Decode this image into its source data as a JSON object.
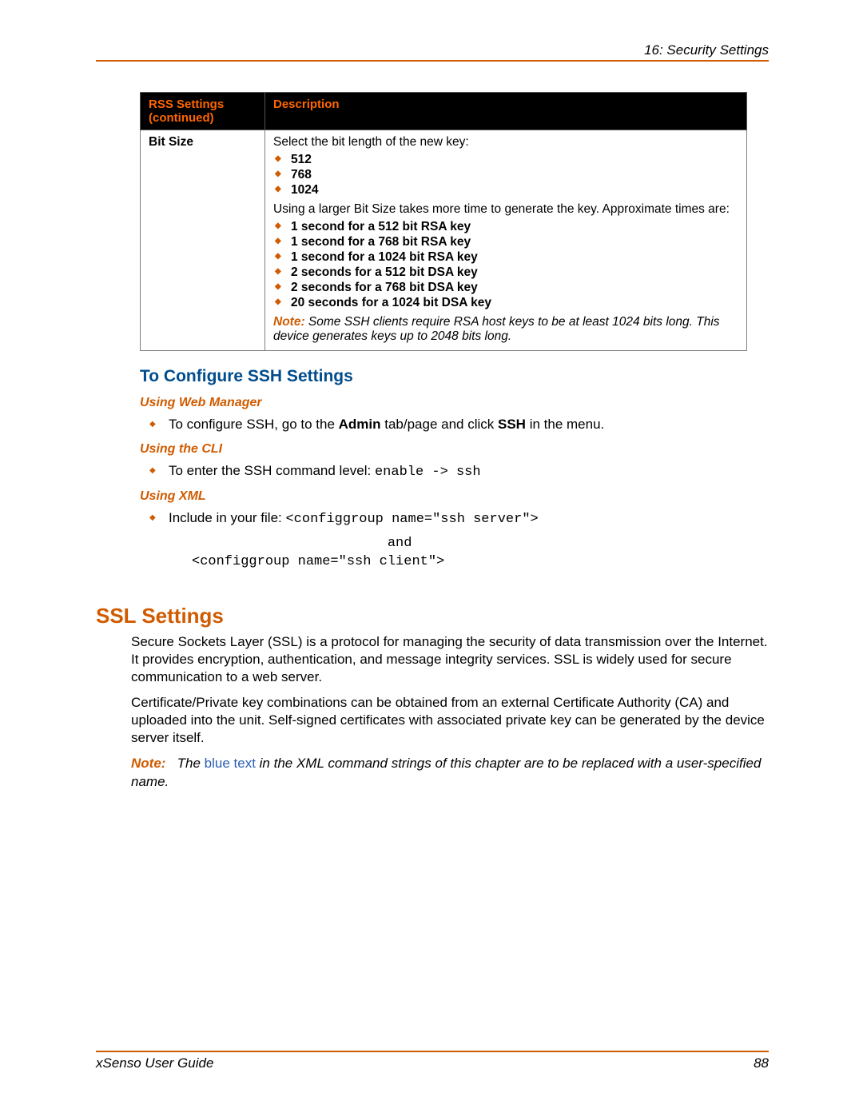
{
  "header": {
    "chapter": "16: Security Settings"
  },
  "table": {
    "columns": [
      "RSS Settings (continued)",
      "Description"
    ],
    "row_label": "Bit Size",
    "select_text": "Select the bit length of the new key:",
    "sizes": [
      "512",
      "768",
      "1024"
    ],
    "larger_text": "Using a larger Bit Size takes more time to generate the key. Approximate times are:",
    "times": [
      "1 second for a 512 bit RSA key",
      "1 second for a 768 bit RSA key",
      "1 second for a 1024 bit RSA key",
      "2 seconds for a 512 bit DSA key",
      "2 seconds for a 768 bit DSA key",
      "20 seconds for a 1024 bit DSA key"
    ],
    "note_label": "Note:",
    "note_text": "Some SSH clients require RSA host keys to be at least 1024 bits long. This device generates keys up to 2048 bits long."
  },
  "ssh": {
    "heading": "To Configure SSH Settings",
    "webmgr_heading": "Using Web Manager",
    "webmgr_text_1": "To configure SSH, go to the ",
    "webmgr_admin": "Admin",
    "webmgr_text_2": " tab/page and click ",
    "webmgr_ssh": "SSH",
    "webmgr_text_3": " in the menu.",
    "cli_heading": "Using the CLI",
    "cli_text": "To enter the SSH command level: ",
    "cli_cmd": "enable -> ssh",
    "xml_heading": "Using XML",
    "xml_text": "Include in your file: ",
    "xml_code_1": "<configgroup name=\"ssh server\">",
    "xml_and": "                        and",
    "xml_code_2": "<configgroup name=\"ssh client\">"
  },
  "ssl": {
    "heading": "SSL Settings",
    "p1": "Secure Sockets Layer (SSL) is a protocol for managing the security of data transmission over the Internet. It provides encryption, authentication, and message integrity services. SSL is widely used for secure communication to a web server.",
    "p2": "Certificate/Private key combinations can be obtained from an external Certificate Authority (CA) and uploaded into the unit. Self-signed certificates with associated private key can be generated by the device server itself.",
    "note_label": "Note:",
    "note_pre": "The ",
    "note_blue": "blue text",
    "note_post": " in the XML command strings of this chapter are to be replaced with a user-specified name."
  },
  "footer": {
    "guide": "xSenso User Guide",
    "page": "88"
  }
}
